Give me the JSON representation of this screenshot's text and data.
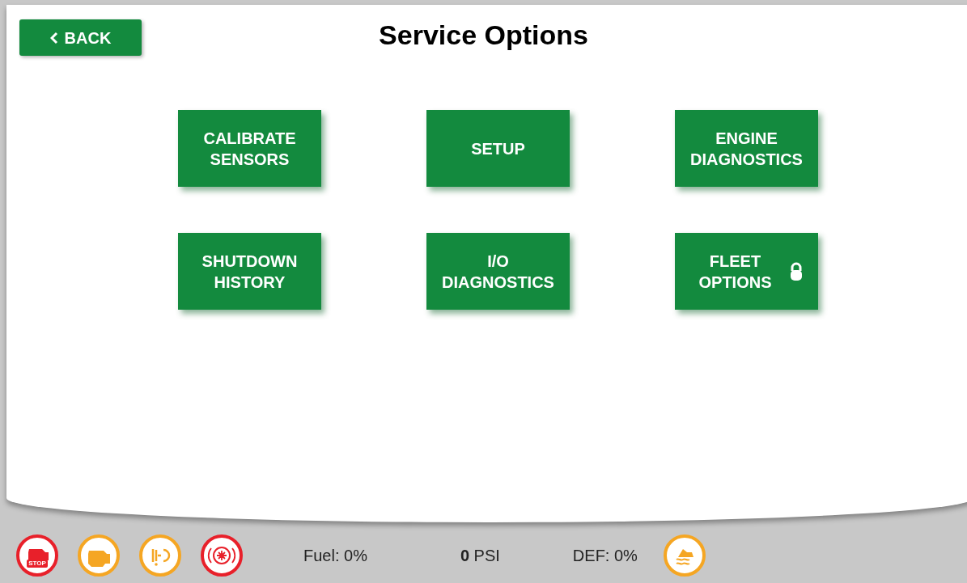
{
  "back_button": {
    "label": "BACK"
  },
  "title": "Service Options",
  "options": [
    {
      "label": "CALIBRATE SENSORS",
      "locked": false
    },
    {
      "label": "SETUP",
      "locked": false
    },
    {
      "label": "ENGINE DIAGNOSTICS",
      "locked": false
    },
    {
      "label": "SHUTDOWN HISTORY",
      "locked": false
    },
    {
      "label": "I/O DIAGNOSTICS",
      "locked": false
    },
    {
      "label": "FLEET OPTIONS",
      "locked": true
    }
  ],
  "status_bar": {
    "lamps": [
      {
        "kind": "stop",
        "label": "STOP",
        "color": "#e8202a"
      },
      {
        "kind": "engine",
        "color": "#f5a623"
      },
      {
        "kind": "exhaust",
        "color": "#f5a623"
      },
      {
        "kind": "brake",
        "color": "#e8202a"
      }
    ],
    "fuel": "Fuel: 0%",
    "pressure": "**0** PSI",
    "def": "DEF: 0%",
    "def_lamp": {
      "kind": "def",
      "color": "#f5a623"
    }
  }
}
